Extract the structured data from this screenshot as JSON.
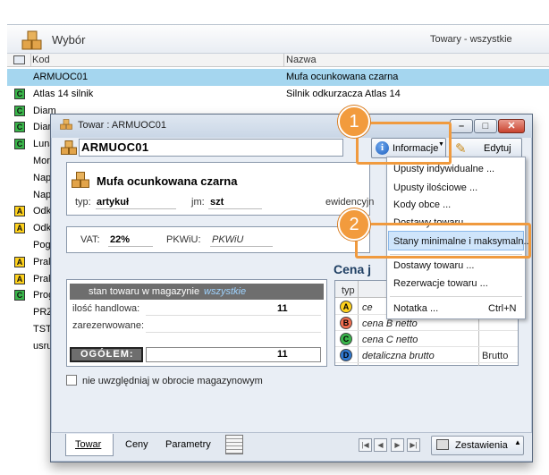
{
  "background": {
    "title": "Wybór",
    "filter": "Towary - wszystkie",
    "columns": {
      "kod": "Kod",
      "nazwa": "Nazwa"
    },
    "rows": [
      {
        "badge": "",
        "kod": "ARMUOC01",
        "nazwa": "Mufa ocunkowana czarna",
        "selected": true
      },
      {
        "badge": "C",
        "kod": "Atlas 14 silnik",
        "nazwa": "Silnik odkurzacza Atlas 14"
      },
      {
        "badge": "C",
        "kod": "Diam",
        "nazwa": ""
      },
      {
        "badge": "C",
        "kod": "Diam",
        "nazwa": ""
      },
      {
        "badge": "C",
        "kod": "Luna",
        "nazwa": ""
      },
      {
        "badge": "",
        "kod": "Mor",
        "nazwa": ""
      },
      {
        "badge": "",
        "kod": "Nap",
        "nazwa": ""
      },
      {
        "badge": "",
        "kod": "Nap",
        "nazwa": ""
      },
      {
        "badge": "A",
        "kod": "Odk",
        "nazwa": ""
      },
      {
        "badge": "A",
        "kod": "Odk",
        "nazwa": ""
      },
      {
        "badge": "",
        "kod": "Pog",
        "nazwa": ""
      },
      {
        "badge": "A",
        "kod": "Prall",
        "nazwa": ""
      },
      {
        "badge": "A",
        "kod": "Prall",
        "nazwa": ""
      },
      {
        "badge": "C",
        "kod": "Prog",
        "nazwa": ""
      },
      {
        "badge": "",
        "kod": "PRZ",
        "nazwa": ""
      },
      {
        "badge": "",
        "kod": "TST",
        "nazwa": ""
      },
      {
        "badge": "",
        "kod": "usru",
        "nazwa": ""
      }
    ]
  },
  "dialog": {
    "title": "Towar : ARMUOC01",
    "code": "ARMUOC01",
    "info_button": "Informacje",
    "edit_button": "Edytuj",
    "product_name": "Mufa ocunkowana czarna",
    "typ_label": "typ:",
    "typ_value": "artykuł",
    "jm_label": "jm:",
    "jm_value": "szt",
    "ewid_label": "ewidencyjn",
    "vat_label": "VAT:",
    "vat_value": "22%",
    "pkwiu_label": "PKWiU:",
    "pkwiu_value": "PKWiU",
    "stock": {
      "header_label": "stan towaru w magazynie",
      "header_value": "wszystkie",
      "hand_label": "ilość handlowa:",
      "hand_value": "11",
      "reserved_label": "zarezerwowane:",
      "total_label": "OGÓŁEM:",
      "total_value": "11"
    },
    "exclude_checkbox": "nie uwzględniaj w obrocie magazynowym",
    "prices": {
      "title": "Cena j",
      "col_typ": "typ",
      "rows": [
        {
          "badge": "A",
          "name": "ce",
          "color": "#ffd21c"
        },
        {
          "badge": "B",
          "name": "cena B netto",
          "color": "#f26d4f"
        },
        {
          "badge": "C",
          "name": "cena C netto",
          "color": "#39b54a"
        },
        {
          "badge": "D",
          "name": "detaliczna brutto",
          "color": "#2f78d1",
          "extra": "Brutto"
        }
      ]
    },
    "tabs": {
      "towar": "Towar",
      "ceny": "Ceny",
      "parametry": "Parametry"
    },
    "setup_button": "Zestawienia",
    "nav": {
      "first": "|◀",
      "prev": "◀",
      "next": "▶",
      "last": "▶|"
    }
  },
  "menu": {
    "items": [
      "Upusty indywidualne ...",
      "Upusty ilościowe ...",
      "Kody obce ...",
      "Dostawy towaru ...",
      "Stany minimalne i maksymaln...",
      "Dostawy towaru ...",
      "Rezerwacje towaru ...",
      "Notatka ..."
    ],
    "shortcut": "Ctrl+N"
  },
  "callouts": {
    "one": "1",
    "two": "2"
  },
  "colors": {
    "accent": "#f09a3e",
    "selection": "#a5d6ef"
  }
}
